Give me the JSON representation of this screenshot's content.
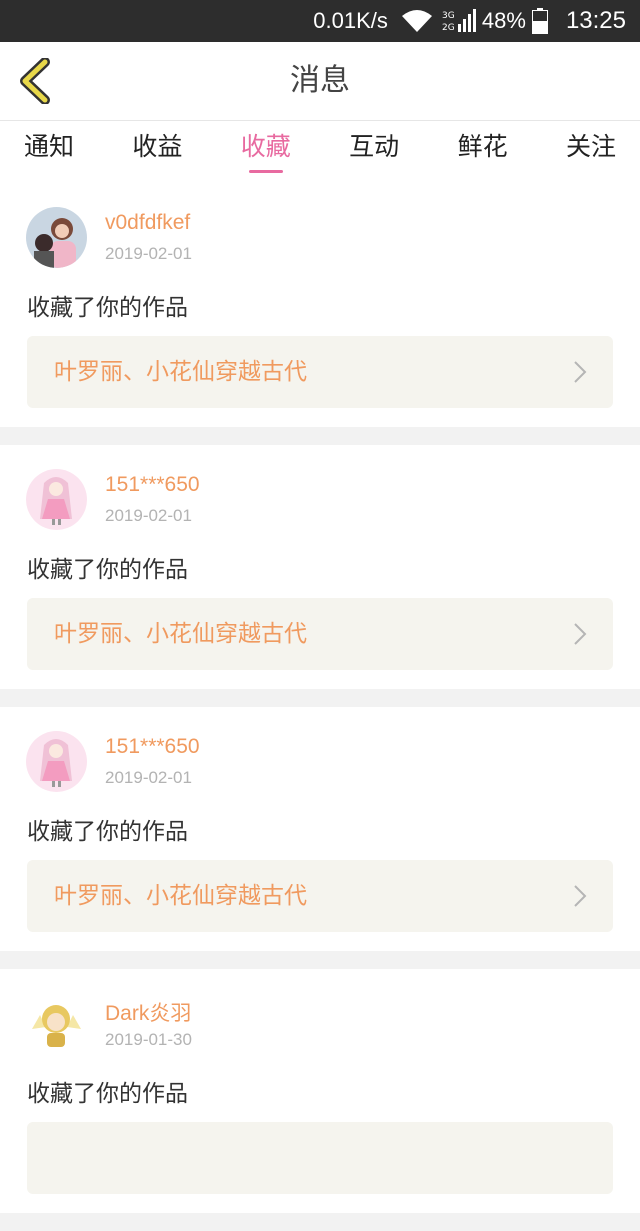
{
  "statusbar": {
    "network_speed": "0.01K/s",
    "battery": "48%",
    "time": "13:25"
  },
  "header": {
    "title": "消息",
    "back_icon": "chevron-left-icon"
  },
  "tabs": [
    {
      "label": "通知",
      "active": false
    },
    {
      "label": "收益",
      "active": false
    },
    {
      "label": "收藏",
      "active": true
    },
    {
      "label": "互动",
      "active": false
    },
    {
      "label": "鲜花",
      "active": false
    },
    {
      "label": "关注",
      "active": false
    }
  ],
  "messages": [
    {
      "username": "v0dfdfkef",
      "date": "2019-02-01",
      "action": "收藏了你的作品",
      "work_title": "叶罗丽、小花仙穿越古代"
    },
    {
      "username": "151***650",
      "date": "2019-02-01",
      "action": "收藏了你的作品",
      "work_title": "叶罗丽、小花仙穿越古代"
    },
    {
      "username": "151***650",
      "date": "2019-02-01",
      "action": "收藏了你的作品",
      "work_title": "叶罗丽、小花仙穿越古代"
    },
    {
      "username": "Dark炎羽",
      "date": "2019-01-30",
      "action": "收藏了你的作品",
      "work_title": ""
    }
  ],
  "colors": {
    "accent": "#e86aa0",
    "username": "#f09a5f",
    "back_icon": "#e8d84a"
  }
}
